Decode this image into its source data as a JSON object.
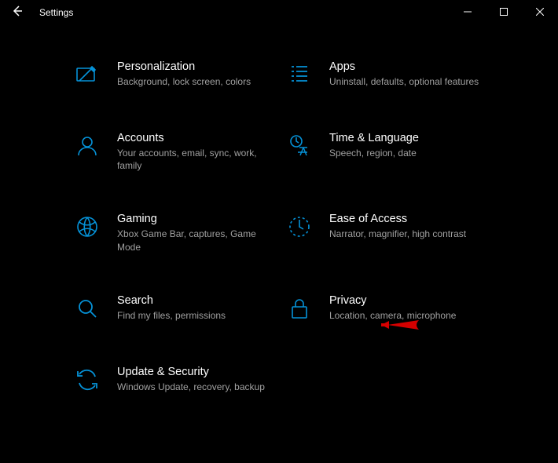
{
  "window": {
    "title": "Settings"
  },
  "accent_color": "#0078d4",
  "categories": [
    {
      "title": "Personalization",
      "desc": "Background, lock screen, colors"
    },
    {
      "title": "Apps",
      "desc": "Uninstall, defaults, optional features"
    },
    {
      "title": "Accounts",
      "desc": "Your accounts, email, sync, work, family"
    },
    {
      "title": "Time & Language",
      "desc": "Speech, region, date"
    },
    {
      "title": "Gaming",
      "desc": "Xbox Game Bar, captures, Game Mode"
    },
    {
      "title": "Ease of Access",
      "desc": "Narrator, magnifier, high contrast"
    },
    {
      "title": "Search",
      "desc": "Find my files, permissions"
    },
    {
      "title": "Privacy",
      "desc": "Location, camera, microphone"
    },
    {
      "title": "Update & Security",
      "desc": "Windows Update, recovery, backup"
    }
  ]
}
